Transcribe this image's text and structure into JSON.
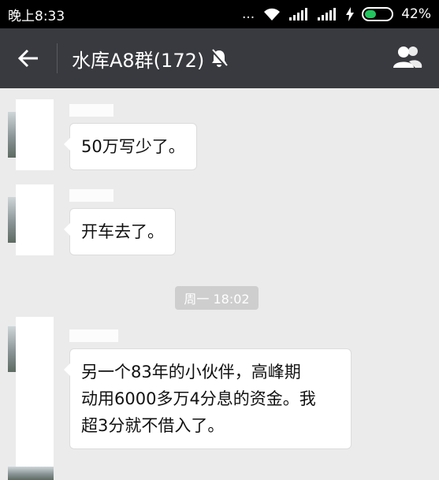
{
  "status_bar": {
    "time": "晚上8:33",
    "dots": "...",
    "battery_percent": "42%",
    "battery_level": 0.42
  },
  "header": {
    "title": "水库A8群(172)",
    "icons": [
      "back-arrow-icon",
      "mute-bell-icon",
      "group-members-icon"
    ]
  },
  "messages": [
    {
      "type": "text",
      "text": "50万写少了。"
    },
    {
      "type": "text",
      "text": "开车去了。"
    },
    {
      "type": "time",
      "text": "周一 18:02"
    },
    {
      "type": "text",
      "lines": [
        "另一个83年的小伙伴，高峰期",
        "动用6000多万4分息的资金。我",
        "超3分就不借入了。"
      ]
    }
  ],
  "colors": {
    "header_bg": "#393a3f",
    "chat_bg": "#ebebeb",
    "battery_green": "#22c55e"
  }
}
